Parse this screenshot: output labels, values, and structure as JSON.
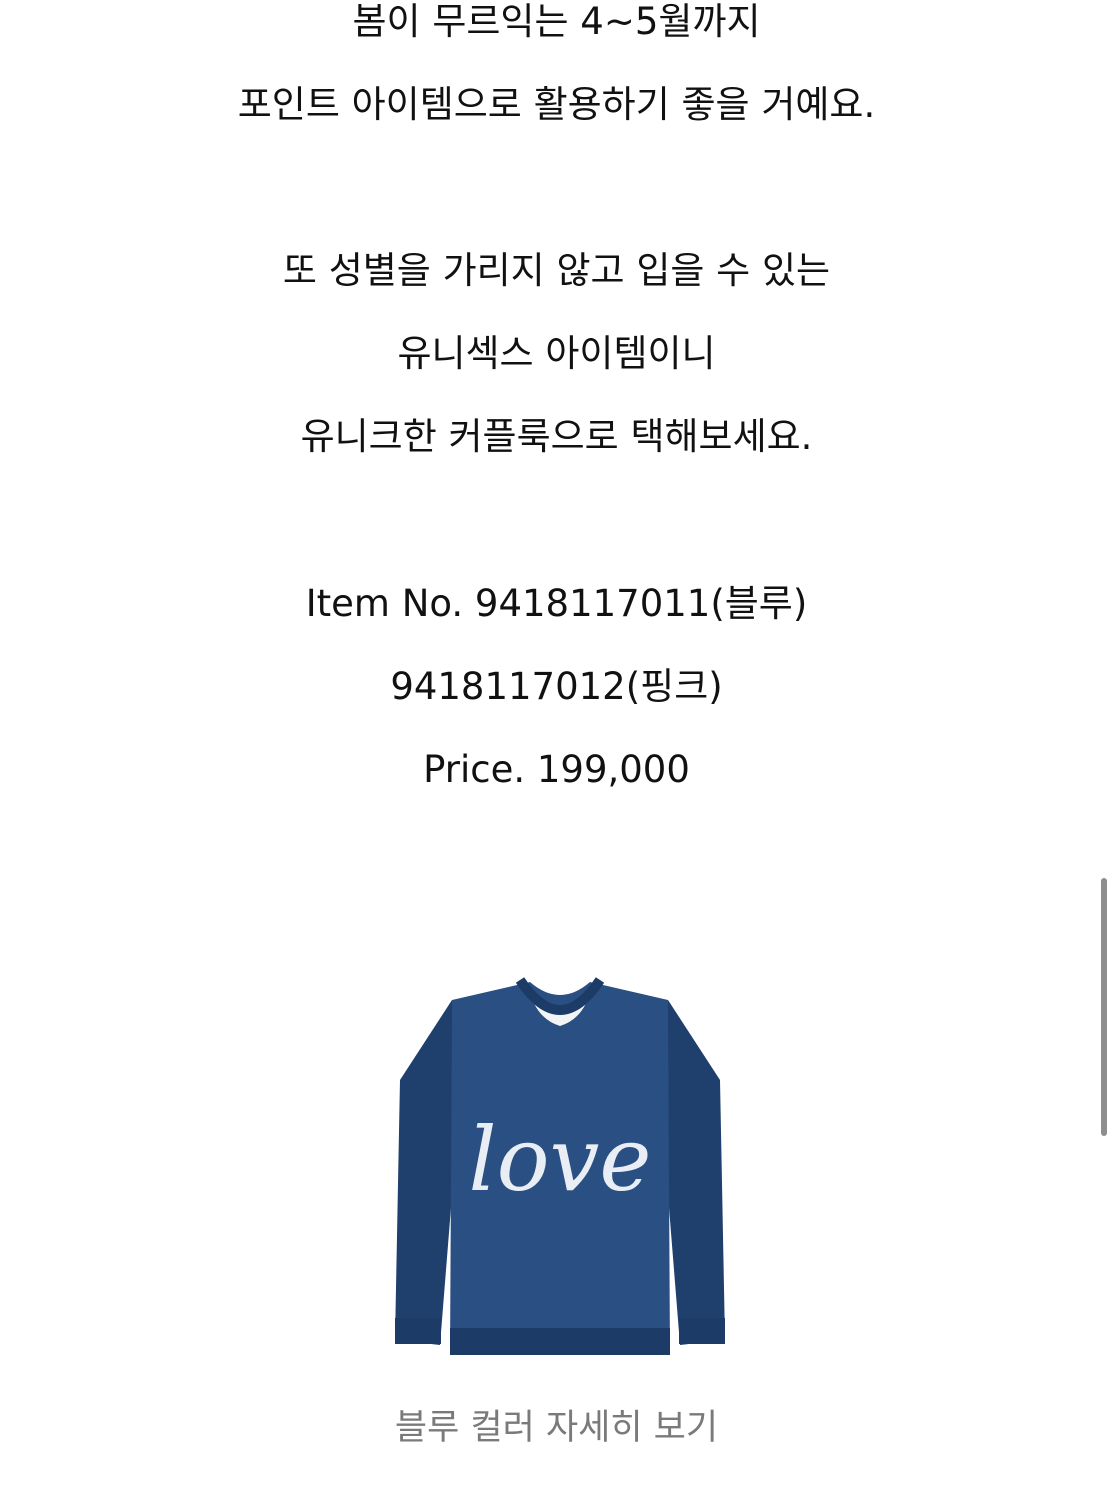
{
  "description": {
    "lines": [
      "봄이 무르익는 4~5월까지",
      "포인트 아이템으로 활용하기 좋을 거예요.",
      "또 성별을 가리지 않고 입을 수 있는",
      "유니섹스 아이템이니",
      "유니크한 커플룩으로 택해보세요."
    ]
  },
  "product": {
    "item_no": "Item No. 9418117011(블루)",
    "item_no_2": "9418117012(핑크)",
    "price": "Price. 199,000",
    "image_alt": "블루 love 니트 스웨터",
    "print_text": "love",
    "colors": {
      "sweater": "#2a4f82",
      "sweater_dark": "#1f3f6d",
      "print": "#e9eef4"
    }
  },
  "link": {
    "blue_detail": "블루 컬러 자세히 보기"
  },
  "scrollbar": {
    "color": "#8e8e8e"
  }
}
